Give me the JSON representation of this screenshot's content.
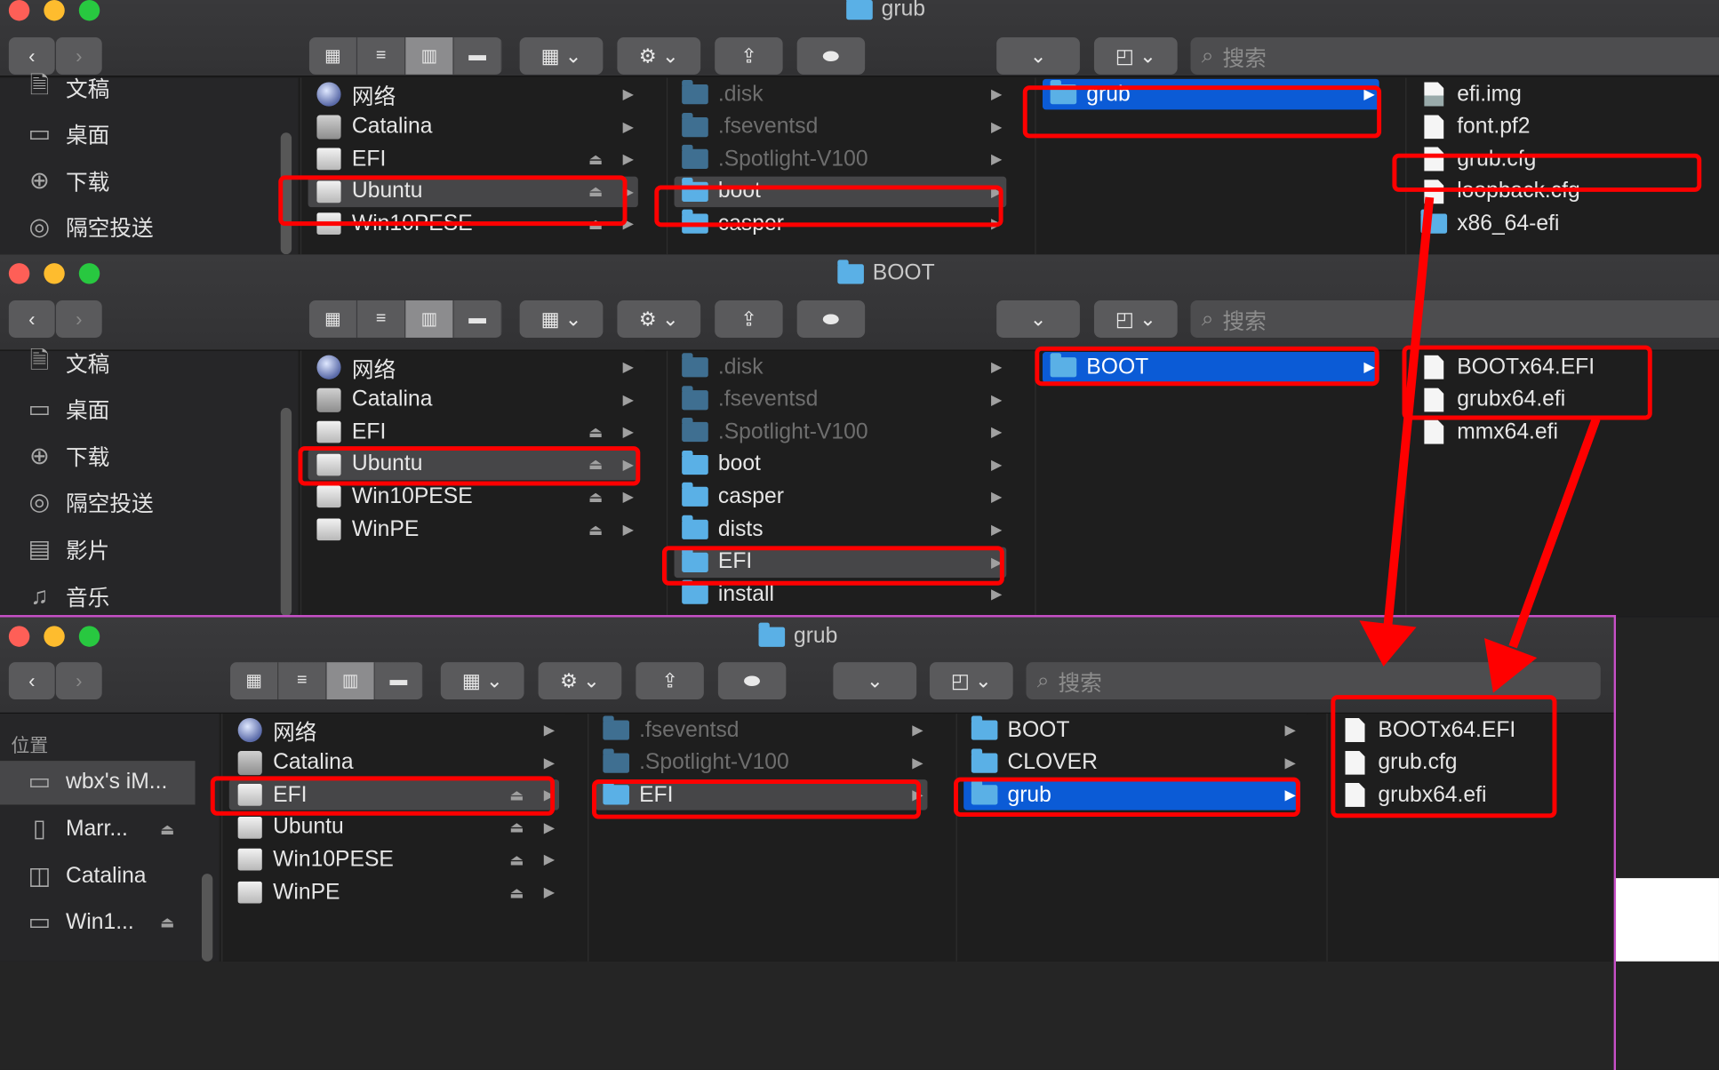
{
  "search_placeholder": "搜索",
  "win1": {
    "title": "grub",
    "sidebar": [
      "文稿",
      "桌面",
      "下载",
      "隔空投送"
    ],
    "col1": [
      {
        "label": "网络",
        "icon": "globe"
      },
      {
        "label": "Catalina",
        "icon": "hdd"
      },
      {
        "label": "EFI",
        "icon": "disk",
        "eject": true
      },
      {
        "label": "Ubuntu",
        "icon": "disk",
        "eject": true,
        "sel": "gray"
      },
      {
        "label": "Win10PESE",
        "icon": "disk",
        "eject": true
      }
    ],
    "col2": [
      {
        "label": ".disk",
        "dim": true
      },
      {
        "label": ".fseventsd",
        "dim": true
      },
      {
        "label": ".Spotlight-V100",
        "dim": true
      },
      {
        "label": "boot",
        "sel": "gray"
      },
      {
        "label": "casper"
      }
    ],
    "col3": [
      {
        "label": "grub",
        "sel": "blue"
      }
    ],
    "col4": [
      {
        "label": "efi.img",
        "file": "img"
      },
      {
        "label": "font.pf2",
        "file": "doc"
      },
      {
        "label": "grub.cfg",
        "file": "doc"
      },
      {
        "label": "loopback.cfg",
        "file": "doc"
      },
      {
        "label": "x86_64-efi",
        "folder": true
      }
    ]
  },
  "win2": {
    "title": "BOOT",
    "sidebar": [
      "文稿",
      "桌面",
      "下载",
      "隔空投送",
      "影片",
      "音乐"
    ],
    "col1": [
      {
        "label": "网络",
        "icon": "globe"
      },
      {
        "label": "Catalina",
        "icon": "hdd"
      },
      {
        "label": "EFI",
        "icon": "disk",
        "eject": true
      },
      {
        "label": "Ubuntu",
        "icon": "disk",
        "eject": true,
        "sel": "gray"
      },
      {
        "label": "Win10PESE",
        "icon": "disk",
        "eject": true
      },
      {
        "label": "WinPE",
        "icon": "disk",
        "eject": true
      }
    ],
    "col2": [
      {
        "label": ".disk",
        "dim": true
      },
      {
        "label": ".fseventsd",
        "dim": true
      },
      {
        "label": ".Spotlight-V100",
        "dim": true
      },
      {
        "label": "boot"
      },
      {
        "label": "casper"
      },
      {
        "label": "dists"
      },
      {
        "label": "EFI",
        "sel": "gray"
      },
      {
        "label": "install"
      }
    ],
    "col3": [
      {
        "label": "BOOT",
        "sel": "blue"
      }
    ],
    "col4": [
      {
        "label": "BOOTx64.EFI",
        "file": "doc"
      },
      {
        "label": "grubx64.efi",
        "file": "doc"
      },
      {
        "label": "mmx64.efi",
        "file": "doc"
      }
    ]
  },
  "win3": {
    "title": "grub",
    "sidebar_header": "位置",
    "sidebar": [
      {
        "label": "wbx's iM...",
        "icon": "imac",
        "sel": true
      },
      {
        "label": "Marr...",
        "icon": "disk",
        "eject": true
      },
      {
        "label": "Catalina",
        "icon": "hdd"
      },
      {
        "label": "Win1...",
        "icon": "disk",
        "eject": true
      }
    ],
    "col1": [
      {
        "label": "网络",
        "icon": "globe"
      },
      {
        "label": "Catalina",
        "icon": "hdd"
      },
      {
        "label": "EFI",
        "icon": "disk",
        "eject": true,
        "sel": "gray"
      },
      {
        "label": "Ubuntu",
        "icon": "disk",
        "eject": true
      },
      {
        "label": "Win10PESE",
        "icon": "disk",
        "eject": true
      },
      {
        "label": "WinPE",
        "icon": "disk",
        "eject": true
      }
    ],
    "col2": [
      {
        "label": ".fseventsd",
        "dim": true
      },
      {
        "label": ".Spotlight-V100",
        "dim": true
      },
      {
        "label": "EFI",
        "sel": "gray"
      }
    ],
    "col3": [
      {
        "label": "BOOT"
      },
      {
        "label": "CLOVER"
      },
      {
        "label": "grub",
        "sel": "blue"
      }
    ],
    "col4": [
      {
        "label": "BOOTx64.EFI",
        "file": "doc"
      },
      {
        "label": "grub.cfg",
        "file": "doc"
      },
      {
        "label": "grubx64.efi",
        "file": "doc"
      }
    ]
  },
  "colors": {
    "highlight": "#ff0000",
    "selection_blue": "#0b5bd6",
    "folder": "#5ab0e6"
  }
}
